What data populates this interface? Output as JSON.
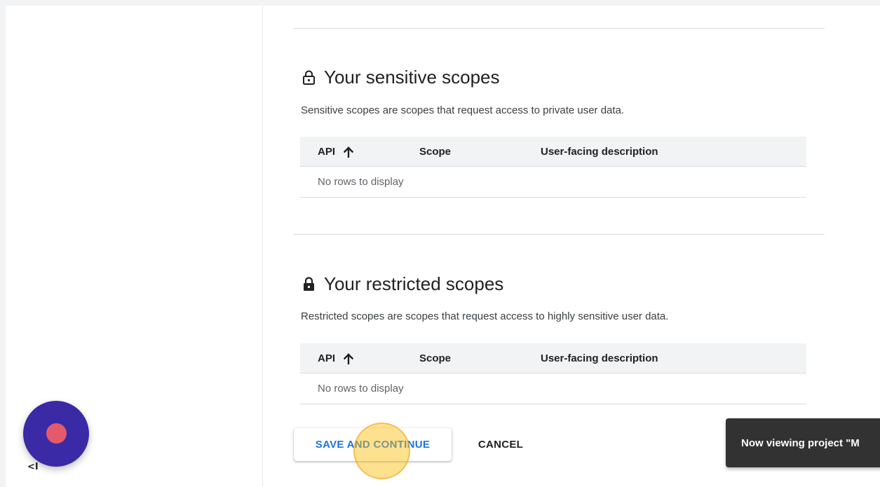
{
  "sensitive": {
    "title": "Your sensitive scopes",
    "icon": "lock-open-outline-icon",
    "description": "Sensitive scopes are scopes that request access to private user data.",
    "columns": [
      "API",
      "Scope",
      "User-facing description"
    ],
    "sort_icon": "arrow-up-icon",
    "empty_text": "No rows to display"
  },
  "restricted": {
    "title": "Your restricted scopes",
    "icon": "lock-filled-icon",
    "description": "Restricted scopes are scopes that request access to highly sensitive user data.",
    "columns": [
      "API",
      "Scope",
      "User-facing description"
    ],
    "sort_icon": "arrow-up-icon",
    "empty_text": "No rows to display"
  },
  "actions": {
    "save_label": "SAVE AND CONTINUE",
    "cancel_label": "CANCEL"
  },
  "toast": {
    "message": "Now viewing project \"M"
  },
  "recorder": {
    "collapse_label": "<I"
  },
  "colors": {
    "accent": "#1a73e8",
    "toast_bg": "#323232",
    "recorder_bg": "#3a2aa6",
    "record_dot": "#e35b6b"
  }
}
